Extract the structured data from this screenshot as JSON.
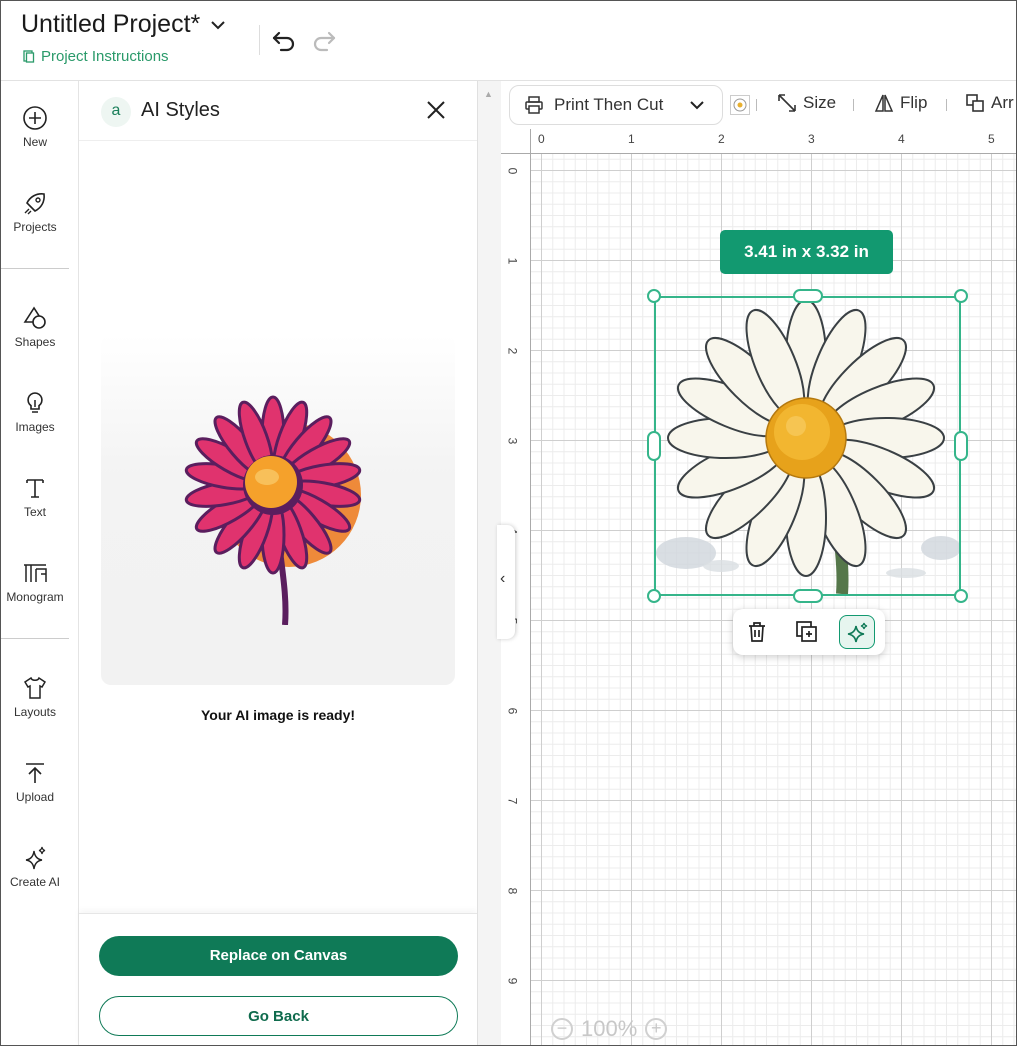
{
  "header": {
    "title": "Untitled Project*",
    "instructions_link": "Project Instructions",
    "icons": [
      "chevron-down-icon",
      "undo-icon",
      "redo-icon"
    ]
  },
  "rail": {
    "items": [
      {
        "label": "New",
        "icon": "plus-circle-icon"
      },
      {
        "label": "Projects",
        "icon": "rocket-icon"
      },
      {
        "label": "Shapes",
        "icon": "shapes-icon"
      },
      {
        "label": "Images",
        "icon": "lightbulb-icon"
      },
      {
        "label": "Text",
        "icon": "text-icon"
      },
      {
        "label": "Monogram",
        "icon": "monogram-icon"
      },
      {
        "label": "Layouts",
        "icon": "shirt-icon"
      },
      {
        "label": "Upload",
        "icon": "upload-icon"
      },
      {
        "label": "Create AI",
        "icon": "sparkle-icon"
      }
    ]
  },
  "panel": {
    "logo": "a",
    "title": "AI Styles",
    "ready_message": "Your AI image is ready!",
    "replace_button": "Replace on Canvas",
    "back_button": "Go Back"
  },
  "toolbar": {
    "operation": "Print Then Cut",
    "size_label": "Size",
    "flip_label": "Flip",
    "arrange_label": "Arr"
  },
  "rulers": {
    "top": [
      "0",
      "1",
      "2",
      "3",
      "4",
      "5"
    ],
    "left": [
      "0",
      "1",
      "2",
      "3",
      "4",
      "5",
      "6",
      "7",
      "8",
      "9"
    ]
  },
  "selection": {
    "dimensions": "3.41  in x 3.32  in"
  },
  "zoom": {
    "level": "100%",
    "minus": "−",
    "plus": "+"
  },
  "colors": {
    "brand_green": "#0f7a57",
    "selection_green": "#35b58a",
    "badge_green": "#129970"
  }
}
